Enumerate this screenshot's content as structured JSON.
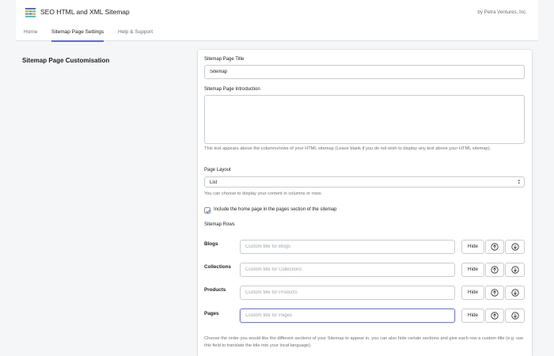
{
  "header": {
    "app_title": "SEO HTML and XML Sitemap",
    "company": "by Petra Ventures, Inc.",
    "logo_icon": "bar-chart-logo-icon"
  },
  "nav": {
    "tabs": [
      {
        "label": "Home",
        "active": false
      },
      {
        "label": "Sitemap Page Settings",
        "active": true
      },
      {
        "label": "Help & Support",
        "active": false
      }
    ]
  },
  "section": {
    "title": "Sitemap Page Customisation"
  },
  "form": {
    "title_label": "Sitemap Page Title",
    "title_value": "Sitemap",
    "intro_label": "Sitemap Page Introduction",
    "intro_value": "",
    "intro_help": "This text appears above the columns/rows of your HTML sitemap (Leave blank if you do not wish to display any text above your HTML sitemap).",
    "layout_label": "Page Layout",
    "layout_value": "List",
    "layout_help": "You can choose to display your content in columns or rows",
    "homepage_checkbox_label": "Include the home page in the pages section of the sitemap",
    "homepage_checked": true,
    "rows_label": "Sitemap Rows",
    "rows": [
      {
        "label": "Blogs",
        "placeholder": "Custom title for Blogs",
        "hide_label": "Hide"
      },
      {
        "label": "Collections",
        "placeholder": "Custom title for Collections",
        "hide_label": "Hide"
      },
      {
        "label": "Products",
        "placeholder": "Custom title for Products",
        "hide_label": "Hide"
      },
      {
        "label": "Pages",
        "placeholder": "Custom title for Pages",
        "hide_label": "Hide"
      }
    ],
    "rows_help": "Choose the order you would like the different sections of your Sitemap to appear in, you can also hide certain sections and give each row a custom title (e.g. use this field to translate the title into your local language)."
  },
  "icons": {
    "move_up": "arrow-up-circle-icon",
    "move_down": "arrow-down-circle-icon",
    "select": "select-chevrons-icon",
    "check": "checkmark-icon"
  },
  "colors": {
    "accent": "#5c6ac4",
    "logo_blue": "#5c6ac4",
    "logo_orange": "#f49342",
    "logo_green": "#50b83c"
  }
}
